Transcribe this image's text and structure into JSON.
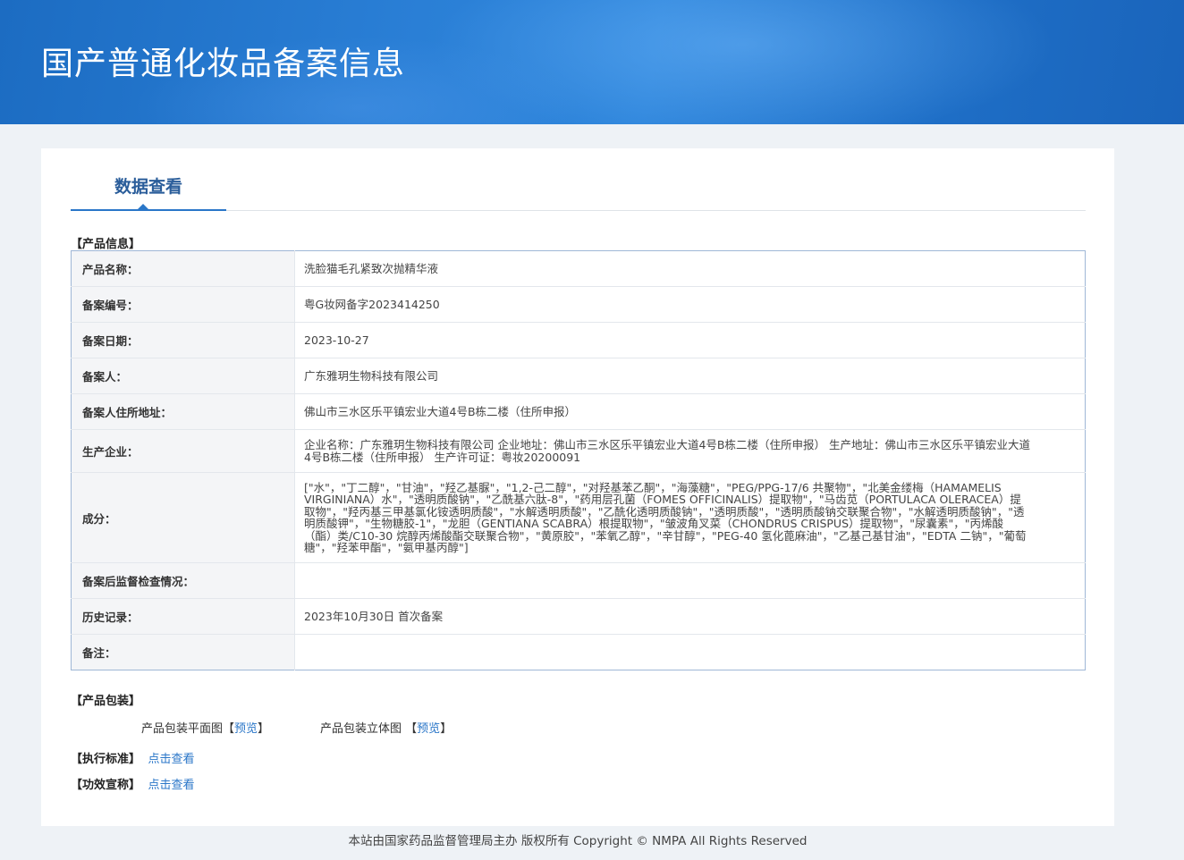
{
  "header": {
    "title": "国产普通化妆品备案信息"
  },
  "tab": {
    "label": "数据查看"
  },
  "sections": {
    "product_info": "【产品信息】",
    "product_packaging": "【产品包装】",
    "standard": "【执行标准】",
    "efficacy": "【功效宣称】"
  },
  "rows": [
    {
      "label": "产品名称：",
      "value": "洗脸猫毛孔紧致次抛精华液"
    },
    {
      "label": "备案编号：",
      "value": "粤G妆网备字2023414250"
    },
    {
      "label": "备案日期：",
      "value": "2023-10-27"
    },
    {
      "label": "备案人：",
      "value": "广东雅玥生物科技有限公司"
    },
    {
      "label": "备案人住所地址：",
      "value": "佛山市三水区乐平镇宏业大道4号B栋二楼（住所申报）"
    },
    {
      "label": "生产企业：",
      "value": "企业名称：广东雅玥生物科技有限公司 企业地址：佛山市三水区乐平镇宏业大道4号B栋二楼（住所申报） 生产地址：佛山市三水区乐平镇宏业大道4号B栋二楼（住所申报） 生产许可证：粤妆20200091"
    },
    {
      "label": "成分：",
      "value": "[\"水\"，\"丁二醇\"，\"甘油\"，\"羟乙基脲\"，\"1,2-己二醇\"，\"对羟基苯乙酮\"，\"海藻糖\"，\"PEG/PPG-17/6 共聚物\"，\"北美金缕梅（HAMAMELIS VIRGINIANA）水\"，\"透明质酸钠\"，\"乙酰基六肽-8\"，\"药用层孔菌（FOMES OFFICINALIS）提取物\"，\"马齿苋（PORTULACA OLERACEA）提取物\"，\"羟丙基三甲基氯化铵透明质酸\"，\"水解透明质酸\"，\"乙酰化透明质酸钠\"，\"透明质酸\"，\"透明质酸钠交联聚合物\"，\"水解透明质酸钠\"，\"透明质酸钾\"，\"生物糖胶-1\"，\"龙胆（GENTIANA SCABRA）根提取物\"，\"皱波角叉菜（CHONDRUS CRISPUS）提取物\"，\"尿囊素\"，\"丙烯酸（酯）类/C10-30 烷醇丙烯酸酯交联聚合物\"，\"黄原胶\"，\"苯氧乙醇\"，\"辛甘醇\"，\"PEG-40 氢化蓖麻油\"，\"乙基己基甘油\"，\"EDTA 二钠\"，\"葡萄糖\"，\"羟苯甲酯\"，\"氨甲基丙醇\"]"
    },
    {
      "label": "备案后监督检查情况：",
      "value": ""
    },
    {
      "label": "历史记录：",
      "value": "2023年10月30日 首次备案"
    },
    {
      "label": "备注：",
      "value": ""
    }
  ],
  "packaging": {
    "flat_label": "产品包装平面图",
    "solid_label": "产品包装立体图",
    "bracket_open": "【",
    "bracket_close": "】",
    "preview": "预览"
  },
  "links": {
    "view": "点击查看"
  },
  "footer": {
    "text": "本站由国家药品监督管理局主办 版权所有 Copyright © NMPA All Rights Reserved"
  }
}
